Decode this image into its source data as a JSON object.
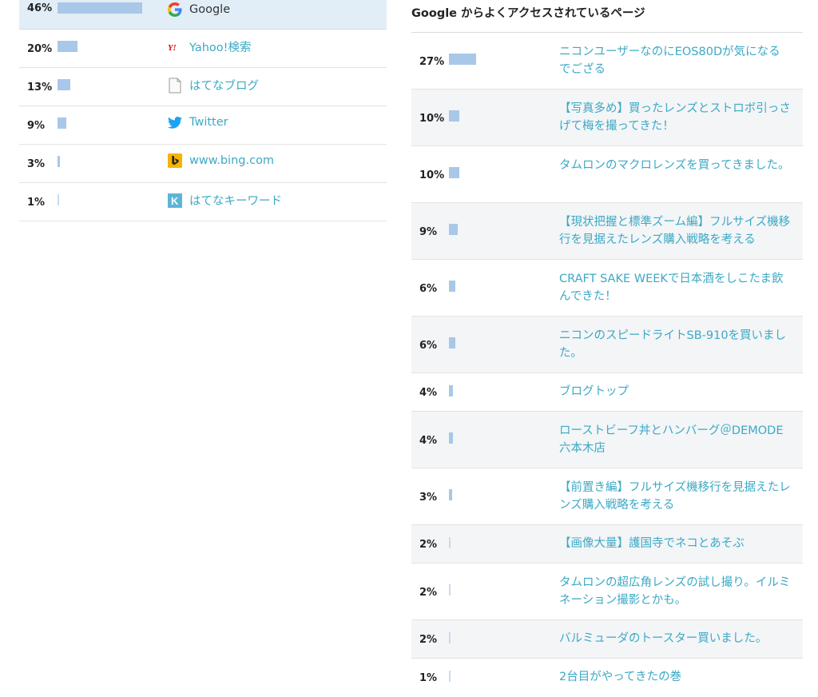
{
  "referrers": [
    {
      "percent": "46%",
      "share": 0.46,
      "source": "Google",
      "icon": "google-icon",
      "link": false
    },
    {
      "percent": "20%",
      "share": 0.2,
      "source": "Yahoo!検索",
      "icon": "yahoo-icon",
      "link": true
    },
    {
      "percent": "13%",
      "share": 0.13,
      "source": "はてなブログ",
      "icon": "document-icon",
      "link": true
    },
    {
      "percent": "9%",
      "share": 0.09,
      "source": "Twitter",
      "icon": "twitter-icon",
      "link": true
    },
    {
      "percent": "3%",
      "share": 0.03,
      "source": "www.bing.com",
      "icon": "bing-icon",
      "link": true
    },
    {
      "percent": "1%",
      "share": 0.01,
      "source": "はてなキーワード",
      "icon": "hatena-keyword-icon",
      "link": true
    }
  ],
  "pages_section": {
    "title": "Google からよくアクセスされているページ",
    "rows": [
      {
        "percent": "27%",
        "share": 0.27,
        "title": "ニコンユーザーなのにEOS80Dが気になるでござる"
      },
      {
        "percent": "10%",
        "share": 0.1,
        "title": "【写真多め】買ったレンズとストロボ引っさげて梅を撮ってきた！"
      },
      {
        "percent": "10%",
        "share": 0.1,
        "title": "タムロンのマクロレンズを買ってきました。"
      },
      {
        "percent": "9%",
        "share": 0.09,
        "title": "【現状把握と標準ズーム編】フルサイズ機移行を見据えたレンズ購入戦略を考える"
      },
      {
        "percent": "6%",
        "share": 0.06,
        "title": "CRAFT SAKE WEEKで日本酒をしこたま飲んできた！"
      },
      {
        "percent": "6%",
        "share": 0.06,
        "title": "ニコンのスピードライトSB-910を買いました。"
      },
      {
        "percent": "4%",
        "share": 0.04,
        "title": "ブログトップ"
      },
      {
        "percent": "4%",
        "share": 0.04,
        "title": "ローストビーフ丼とハンバーグ＠DEMODE六本木店"
      },
      {
        "percent": "3%",
        "share": 0.03,
        "title": "【前置き編】フルサイズ機移行を見据えたレンズ購入戦略を考える"
      },
      {
        "percent": "2%",
        "share": 0.02,
        "title": "【画像大量】護国寺でネコとあそぶ"
      },
      {
        "percent": "2%",
        "share": 0.02,
        "title": "タムロンの超広角レンズの試し撮り。イルミネーション撮影とかも。"
      },
      {
        "percent": "2%",
        "share": 0.02,
        "title": "バルミューダのトースター買いました。"
      },
      {
        "percent": "1%",
        "share": 0.01,
        "title": "2台目がやってきたの巻"
      }
    ]
  },
  "colors": {
    "bar": "#a9c7e8",
    "link": "#3ca9c4",
    "highlight": "#e1eef7"
  }
}
